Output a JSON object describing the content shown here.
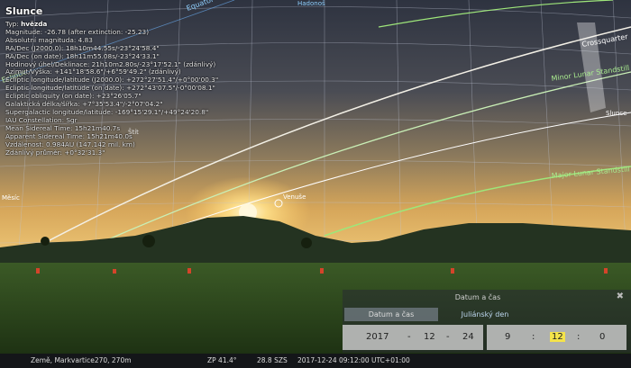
{
  "info": {
    "title": "Slunce",
    "type_label": "Typ:",
    "type_value": "hvězda",
    "magnitude": "Magnitude: -26.78 (after extinction: -25.23)",
    "abs_magnitude": "Absolutní magnituda: 4.83",
    "radec_j2000": "RA/Dec (J2000.0):  18h10m44.55s/-23°24'58.4\"",
    "radec_date": "RA/Dec (on date):  18h11m55.08s/-23°24'33.1\"",
    "hour_angle": "Hodinový úhel/Deklinace: 21h10m2.80s/-23°17'52.1\" (zdánlivý)",
    "azalt": "Azimut/Výška: +141°18'58.6\"/+6°59'49.2\" (zdánlivý)",
    "ecl_j2000": "Ecliptic longitude/latitude (J2000.0):  +272°27'51.4\"/+0°00'00.3\"",
    "ecl_date": "Ecliptic longitude/latitude (on date): +272°43'07.5\"/-0°00'08.1\"",
    "ecl_obliquity": "Ecliptic obliquity (on date): +23°26'05.7\"",
    "galactic": "Galaktická délka/šířka: +7°35'53.4\"/-2°07'04.2\"",
    "supergalactic": "Supergalactic longitude/latitude: -169°15'29.1\"/+49°24'20.8\"",
    "iau": "IAU Constellation: Sgr",
    "mean_sidereal": "Mean Sidereal Time: 15h21m40.7s",
    "apparent_sidereal": "Apparent Sidereal Time: 15h21m40.0s",
    "distance": "Vzdálenost: 0.984AU (147.142 mil. km)",
    "apparent_diameter": "Zdánlivý průměr: +0°32'31.3\""
  },
  "sky_labels": {
    "equator": "Equator",
    "ecliptic": "Ecliptic",
    "crossquarter": "Crossquarter",
    "minor_lunar": "Minor Lunar Standstill",
    "major_lunar": "Major Lunar Standstill",
    "sun": "Slunce",
    "venus": "Venuše",
    "moon": "Měsíc",
    "shield": "Štít",
    "hadovka": "Hadonoš"
  },
  "colors": {
    "ecliptic": "#9ee67a",
    "equator": "#6fb8ff",
    "standstill": "#7ee070",
    "grid": "#bfc6d6"
  },
  "date_panel": {
    "title": "Datum a čas",
    "tab_date": "Datum a čas",
    "tab_julian": "Juliánský den",
    "year": "2017",
    "month": "12",
    "day": "24",
    "hour": "9",
    "minute": "12",
    "second": "0",
    "sep_dash": "-",
    "sep_colon": ":"
  },
  "status": {
    "location": "Země, Markvartice270, 270m",
    "fov": "ZP 41.4°",
    "fps": "28.8 SZS",
    "datetime": "2017-12-24 09:12:00 UTC+01:00"
  }
}
